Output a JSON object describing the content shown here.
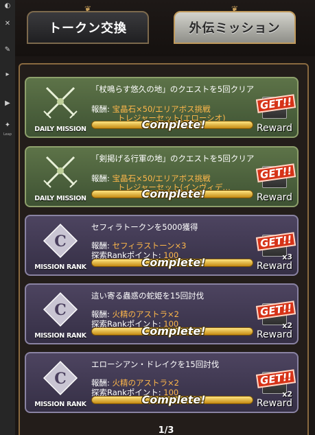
{
  "tabs": [
    {
      "label": "トークン交換",
      "active": false
    },
    {
      "label": "外伝ミッション",
      "active": true
    }
  ],
  "sidebar": {
    "item_label": "Leap"
  },
  "missions": [
    {
      "emblem": "DAILY MISSION",
      "title": "「杖鳴らす悠久の地」のクエストを5回クリア",
      "reward_prefix": "報酬:",
      "reward_line1": "宝晶石×50/エリアボス挑戦",
      "reward_line2": "トレジャーセット(エローシオ)",
      "points_prefix": "",
      "points_value": "",
      "complete_label": "Complete!",
      "button_get": "GET!!",
      "button_label": "Reward",
      "multiplier": ""
    },
    {
      "emblem": "DAILY MISSION",
      "title": "「剣掲げる行軍の地」のクエストを5回クリア",
      "reward_prefix": "報酬:",
      "reward_line1": "宝晶石×50/エリアボス挑戦",
      "reward_line2": "トレジャーセット(インヴィデ…",
      "points_prefix": "",
      "points_value": "",
      "complete_label": "Complete!",
      "button_get": "GET!!",
      "button_label": "Reward",
      "multiplier": ""
    },
    {
      "emblem": "MISSION RANK",
      "title": "セフィラトークンを5000獲得",
      "reward_prefix": "報酬:",
      "reward_line1": "セフィラストーン×3",
      "reward_line2": "",
      "points_prefix": "探索Rankポイント:",
      "points_value": "100",
      "complete_label": "Complete!",
      "button_get": "GET!!",
      "button_label": "Reward",
      "multiplier": "x3"
    },
    {
      "emblem": "MISSION RANK",
      "title": "這い寄る蟲惑の蛇姫を15回討伐",
      "reward_prefix": "報酬:",
      "reward_line1": "火精のアストラ×2",
      "reward_line2": "",
      "points_prefix": "探索Rankポイント:",
      "points_value": "100",
      "complete_label": "Complete!",
      "button_get": "GET!!",
      "button_label": "Reward",
      "multiplier": "x2"
    },
    {
      "emblem": "MISSION RANK",
      "title": "エローシアン・ドレイクを15回討伐",
      "reward_prefix": "報酬:",
      "reward_line1": "火精のアストラ×2",
      "reward_line2": "",
      "points_prefix": "探索Rankポイント:",
      "points_value": "100",
      "complete_label": "Complete!",
      "button_get": "GET!!",
      "button_label": "Reward",
      "multiplier": "x2"
    }
  ],
  "pagination": "1/3",
  "colors": {
    "daily_card": "#4e6440",
    "rank_card": "#403a53",
    "reward_text": "#ffb84a",
    "frame": "#8a6a40"
  }
}
